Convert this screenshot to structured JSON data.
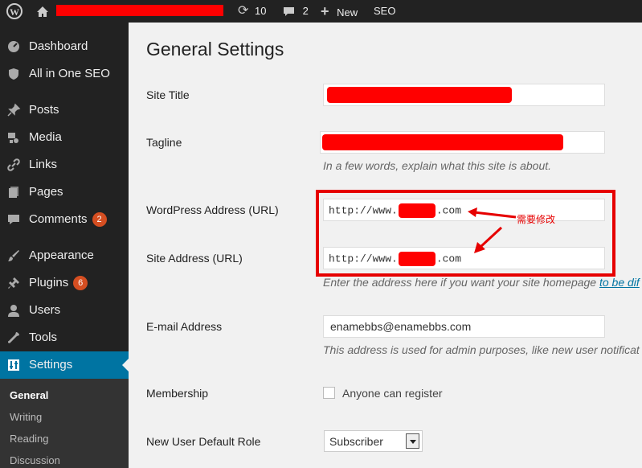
{
  "admin_bar": {
    "updates_count": "10",
    "comments_count": "2",
    "new_label": "New",
    "seo_label": "SEO"
  },
  "sidebar": {
    "items": [
      {
        "label": "Dashboard",
        "icon": "dashboard-icon"
      },
      {
        "label": "All in One SEO",
        "icon": "shield-icon"
      },
      {
        "label": "Posts",
        "icon": "pin-icon"
      },
      {
        "label": "Media",
        "icon": "media-icon"
      },
      {
        "label": "Links",
        "icon": "link-icon"
      },
      {
        "label": "Pages",
        "icon": "pages-icon"
      },
      {
        "label": "Comments",
        "icon": "comment-icon",
        "badge": "2"
      },
      {
        "label": "Appearance",
        "icon": "brush-icon"
      },
      {
        "label": "Plugins",
        "icon": "plug-icon",
        "badge": "6"
      },
      {
        "label": "Users",
        "icon": "user-icon"
      },
      {
        "label": "Tools",
        "icon": "wrench-icon"
      },
      {
        "label": "Settings",
        "icon": "settings-icon"
      }
    ],
    "submenu": [
      "General",
      "Writing",
      "Reading",
      "Discussion"
    ]
  },
  "page": {
    "title": "General Settings",
    "site_title_label": "Site Title",
    "tagline_label": "Tagline",
    "tagline_desc": "In a few words, explain what this site is about.",
    "wp_address_label": "WordPress Address (URL)",
    "wp_address_prefix": "http://www.",
    "wp_address_suffix": ".com",
    "site_address_label": "Site Address (URL)",
    "site_address_prefix": "http://www.",
    "site_address_suffix": ".com",
    "address_desc": "Enter the address here if you want your site homepage ",
    "address_desc_link": "to be dif",
    "email_label": "E-mail Address",
    "email_value": "enamebbs@enamebbs.com",
    "email_desc": "This address is used for admin purposes, like new user notificat",
    "membership_label": "Membership",
    "membership_checkbox_label": "Anyone can register",
    "default_role_label": "New User Default Role",
    "default_role_value": "Subscriber"
  },
  "annotation": {
    "note": "需要修改",
    "color": "#e60000"
  },
  "colors": {
    "admin_bar_bg": "#222222",
    "sidebar_bg": "#222222",
    "active_bg": "#0074a2",
    "badge_bg": "#d54e21",
    "redaction": "#ff0000"
  }
}
